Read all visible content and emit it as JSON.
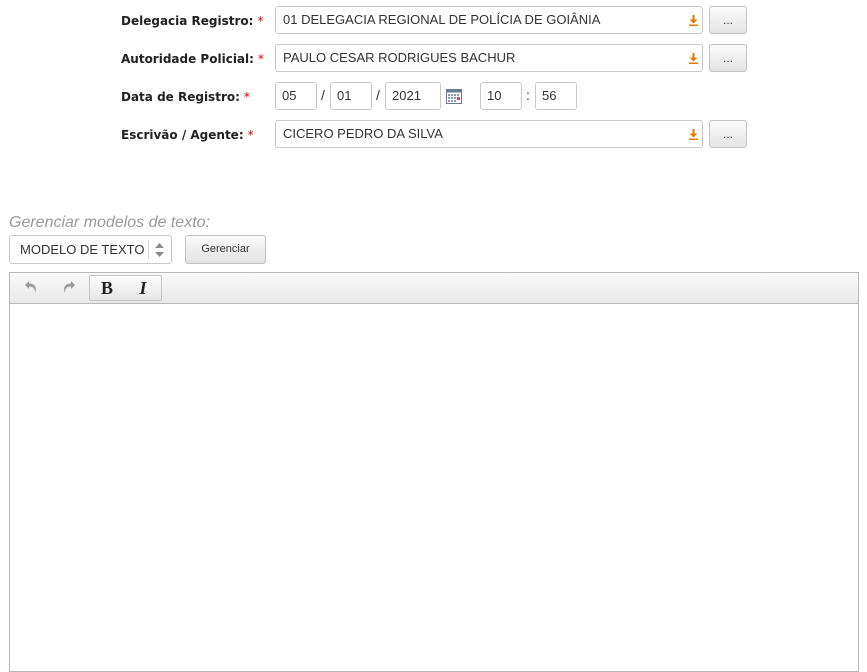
{
  "form": {
    "delegacia": {
      "label": "Delegacia Registro:",
      "required": "*",
      "value": "01 DELEGACIA REGIONAL DE POLÍCIA DE GOIÂNIA",
      "button": "..."
    },
    "autoridade": {
      "label": "Autoridade Policial:",
      "required": "*",
      "value": "PAULO CESAR RODRIGUES BACHUR",
      "button": "..."
    },
    "data_registro": {
      "label": "Data de Registro:",
      "required": "*",
      "day": "05",
      "month": "01",
      "year": "2021",
      "date_sep": "/",
      "hour": "10",
      "minute": "56",
      "time_sep": ":"
    },
    "escrivao": {
      "label": "Escrivão / Agente:",
      "required": "*",
      "value": "CICERO PEDRO DA SILVA",
      "button": "..."
    }
  },
  "models": {
    "label": "Gerenciar modelos de texto:",
    "selected": "MODELO DE TEXTO",
    "manage_button": "Gerenciar"
  },
  "editor": {
    "toolbar": {
      "undo_icon": "undo-icon",
      "redo_icon": "redo-icon",
      "bold": "B",
      "italic": "I"
    },
    "content": ""
  },
  "colors": {
    "required": "#d40000",
    "dropdown_arrow": "#e07b00",
    "models_label": "#9a9a9a"
  }
}
